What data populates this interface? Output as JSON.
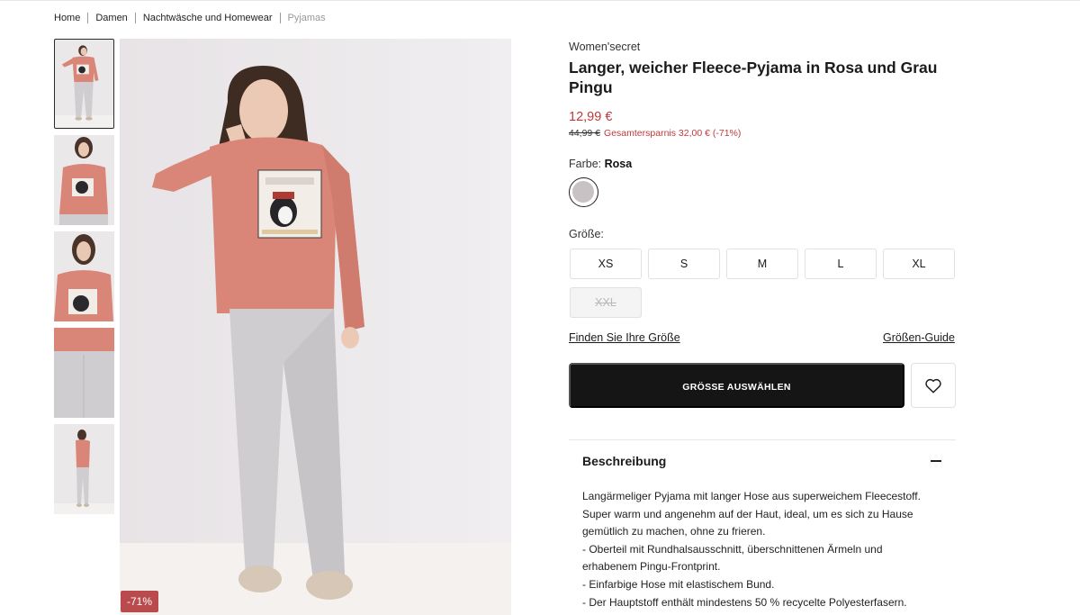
{
  "breadcrumb": {
    "items": [
      "Home",
      "Damen",
      "Nachtwäsche und Homewear"
    ],
    "current": "Pyjamas"
  },
  "gallery": {
    "thumbnail_count": 5,
    "active_index": 0,
    "discount_badge": "-71%"
  },
  "product": {
    "brand": "Women'secret",
    "title": "Langer, weicher Fleece-Pyjama in Rosa und Grau Pingu",
    "price": "12,99 €",
    "old_price": "44,99 €",
    "savings": "Gesamtersparnis 32,00 € (-71%)"
  },
  "color": {
    "label": "Farbe:",
    "value": "Rosa",
    "swatch_color": "#c9c2c5"
  },
  "size": {
    "label": "Größe:",
    "options": [
      "XS",
      "S",
      "M",
      "L",
      "XL",
      "XXL"
    ],
    "unavailable": [
      "XXL"
    ]
  },
  "links": {
    "find_size": "Finden Sie Ihre Größe",
    "size_guide": "Größen-Guide"
  },
  "actions": {
    "select_size": "GRÖSSE AUSWÄHLEN",
    "wishlist_icon": "heart-icon"
  },
  "description": {
    "heading": "Beschreibung",
    "lines": [
      "Langärmeliger Pyjama mit langer Hose aus superweichem Fleecestoff.",
      "Super warm und angenehm auf der Haut, ideal, um es sich zu Hause",
      "gemütlich zu machen, ohne zu frieren.",
      "- Oberteil mit Rundhalsausschnitt, überschnittenen Ärmeln und",
      "erhabenem Pingu-Frontprint.",
      "- Einfarbige Hose mit elastischem Bund.",
      "- Der Hauptstoff enthält mindestens 50 % recycelte Polyesterfasern."
    ]
  },
  "colors": {
    "accent_red": "#c0393b",
    "badge_red": "#b94a4e",
    "button_dark": "#151515",
    "top_pink": "#d98678",
    "pants_grey": "#cfcdcf"
  }
}
